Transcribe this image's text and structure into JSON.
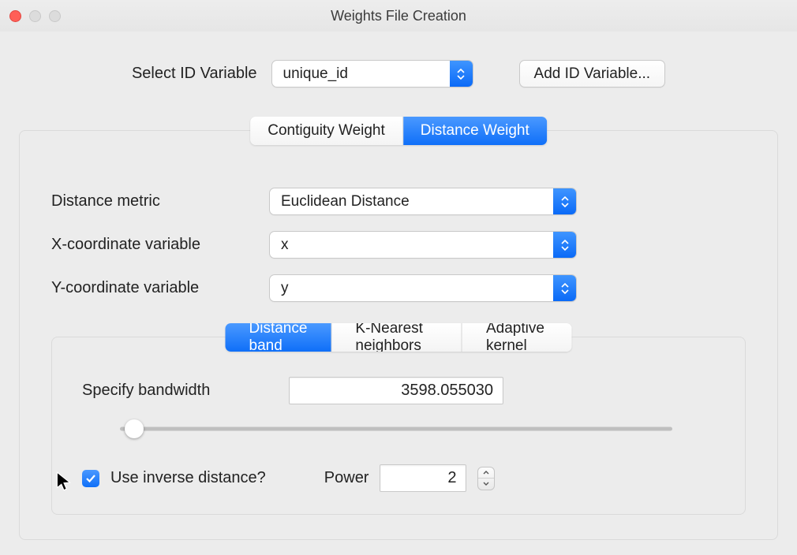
{
  "window": {
    "title": "Weights File Creation"
  },
  "id_row": {
    "label": "Select ID Variable",
    "select_value": "unique_id",
    "add_button": "Add ID Variable..."
  },
  "weight_tabs": {
    "contiguity": "Contiguity Weight",
    "distance": "Distance Weight"
  },
  "metric": {
    "label": "Distance metric",
    "value": "Euclidean Distance"
  },
  "xcoord": {
    "label": "X-coordinate variable",
    "value": "x"
  },
  "ycoord": {
    "label": "Y-coordinate variable",
    "value": "y"
  },
  "method_tabs": {
    "band": "Distance band",
    "knn": "K-Nearest neighbors",
    "adaptive": "Adaptive kernel"
  },
  "bandwidth": {
    "label": "Specify bandwidth",
    "value": "3598.055030"
  },
  "inverse": {
    "label": "Use inverse distance?",
    "power_label": "Power",
    "power_value": "2"
  }
}
